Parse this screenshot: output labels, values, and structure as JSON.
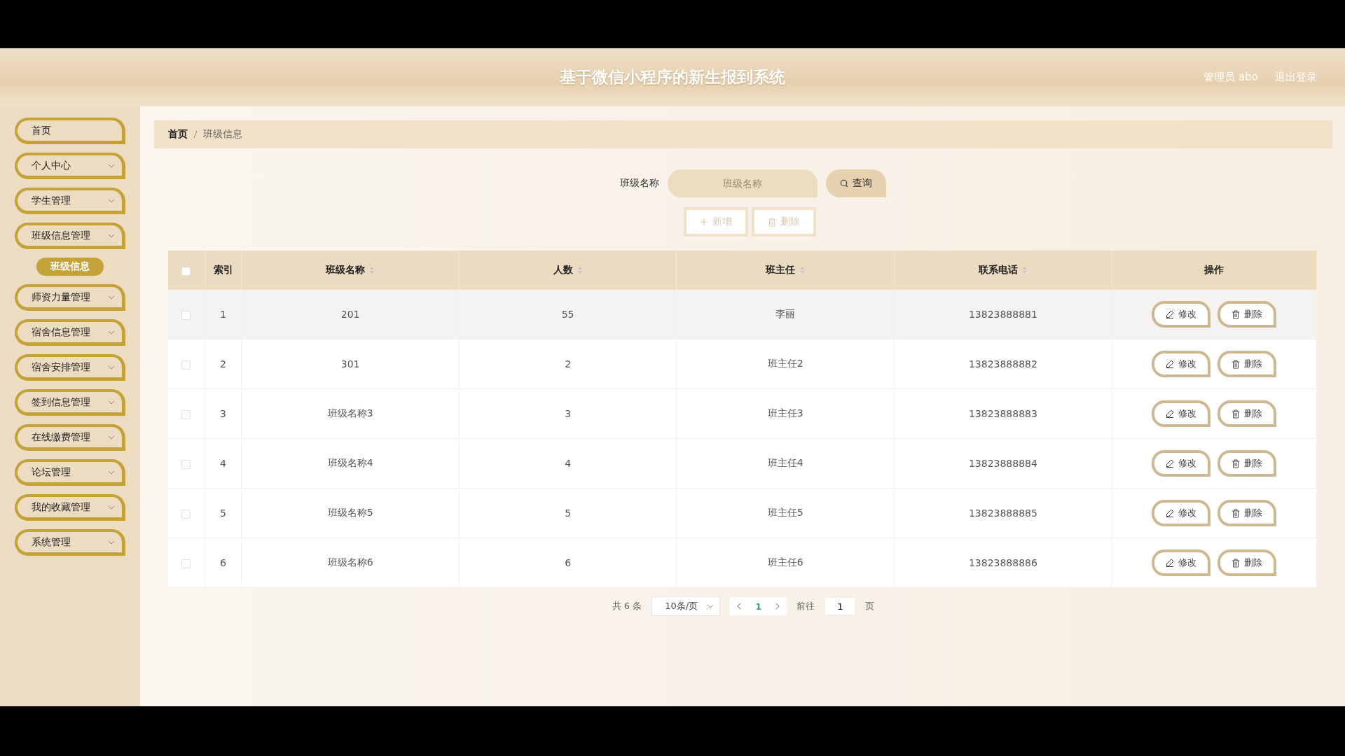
{
  "header": {
    "title": "基于微信小程序的新生报到系统",
    "user": "管理员 abo",
    "logout": "退出登录"
  },
  "sidebar": {
    "items": [
      {
        "kind": "link",
        "label": "首页"
      },
      {
        "kind": "group",
        "label": "个人中心"
      },
      {
        "kind": "group",
        "label": "学生管理"
      },
      {
        "kind": "group",
        "label": "班级信息管理",
        "children": [
          {
            "label": "班级信息",
            "selected": true
          }
        ]
      },
      {
        "kind": "group",
        "label": "师资力量管理"
      },
      {
        "kind": "group",
        "label": "宿舍信息管理"
      },
      {
        "kind": "group",
        "label": "宿舍安排管理"
      },
      {
        "kind": "group",
        "label": "签到信息管理"
      },
      {
        "kind": "group",
        "label": "在线缴费管理"
      },
      {
        "kind": "group",
        "label": "论坛管理"
      },
      {
        "kind": "group",
        "label": "我的收藏管理"
      },
      {
        "kind": "group",
        "label": "系统管理"
      }
    ]
  },
  "breadcrumb": [
    "首页",
    "班级信息"
  ],
  "search": {
    "label": "班级名称",
    "placeholder": "班级名称",
    "button": "查询"
  },
  "actions": [
    {
      "kind": "add",
      "label": "新增"
    },
    {
      "kind": "delete",
      "label": "删除"
    }
  ],
  "table": {
    "columns": [
      {
        "label": "索引",
        "sortable": false
      },
      {
        "label": "班级名称",
        "sortable": true
      },
      {
        "label": "人数",
        "sortable": true
      },
      {
        "label": "班主任",
        "sortable": true
      },
      {
        "label": "联系电话",
        "sortable": true
      },
      {
        "label": "操作",
        "sortable": false
      }
    ],
    "all_checked": false,
    "rows": [
      {
        "checked": false,
        "hovered": true,
        "cells": [
          "1",
          "201",
          "55",
          "李丽",
          "13823888881"
        ],
        "actions": [
          {
            "kind": "edit",
            "label": "修改"
          },
          {
            "kind": "delete",
            "label": "删除"
          }
        ]
      },
      {
        "checked": false,
        "hovered": false,
        "cells": [
          "2",
          "301",
          "2",
          "班主任2",
          "13823888882"
        ],
        "actions": [
          {
            "kind": "edit",
            "label": "修改"
          },
          {
            "kind": "delete",
            "label": "删除"
          }
        ]
      },
      {
        "checked": false,
        "hovered": false,
        "cells": [
          "3",
          "班级名称3",
          "3",
          "班主任3",
          "13823888883"
        ],
        "actions": [
          {
            "kind": "edit",
            "label": "修改"
          },
          {
            "kind": "delete",
            "label": "删除"
          }
        ]
      },
      {
        "checked": false,
        "hovered": false,
        "cells": [
          "4",
          "班级名称4",
          "4",
          "班主任4",
          "13823888884"
        ],
        "actions": [
          {
            "kind": "edit",
            "label": "修改"
          },
          {
            "kind": "delete",
            "label": "删除"
          }
        ]
      },
      {
        "checked": false,
        "hovered": false,
        "cells": [
          "5",
          "班级名称5",
          "5",
          "班主任5",
          "13823888885"
        ],
        "actions": [
          {
            "kind": "edit",
            "label": "修改"
          },
          {
            "kind": "delete",
            "label": "删除"
          }
        ]
      },
      {
        "checked": false,
        "hovered": false,
        "cells": [
          "6",
          "班级名称6",
          "6",
          "班主任6",
          "13823888886"
        ],
        "actions": [
          {
            "kind": "edit",
            "label": "修改"
          },
          {
            "kind": "delete",
            "label": "删除"
          }
        ]
      }
    ]
  },
  "pagination": {
    "total": "共 6 条",
    "page_size": "10条/页",
    "pages": [
      {
        "label": "1",
        "selected": true
      }
    ],
    "goto_label": "前往",
    "goto_value": "1",
    "goto_suffix": "页"
  }
}
